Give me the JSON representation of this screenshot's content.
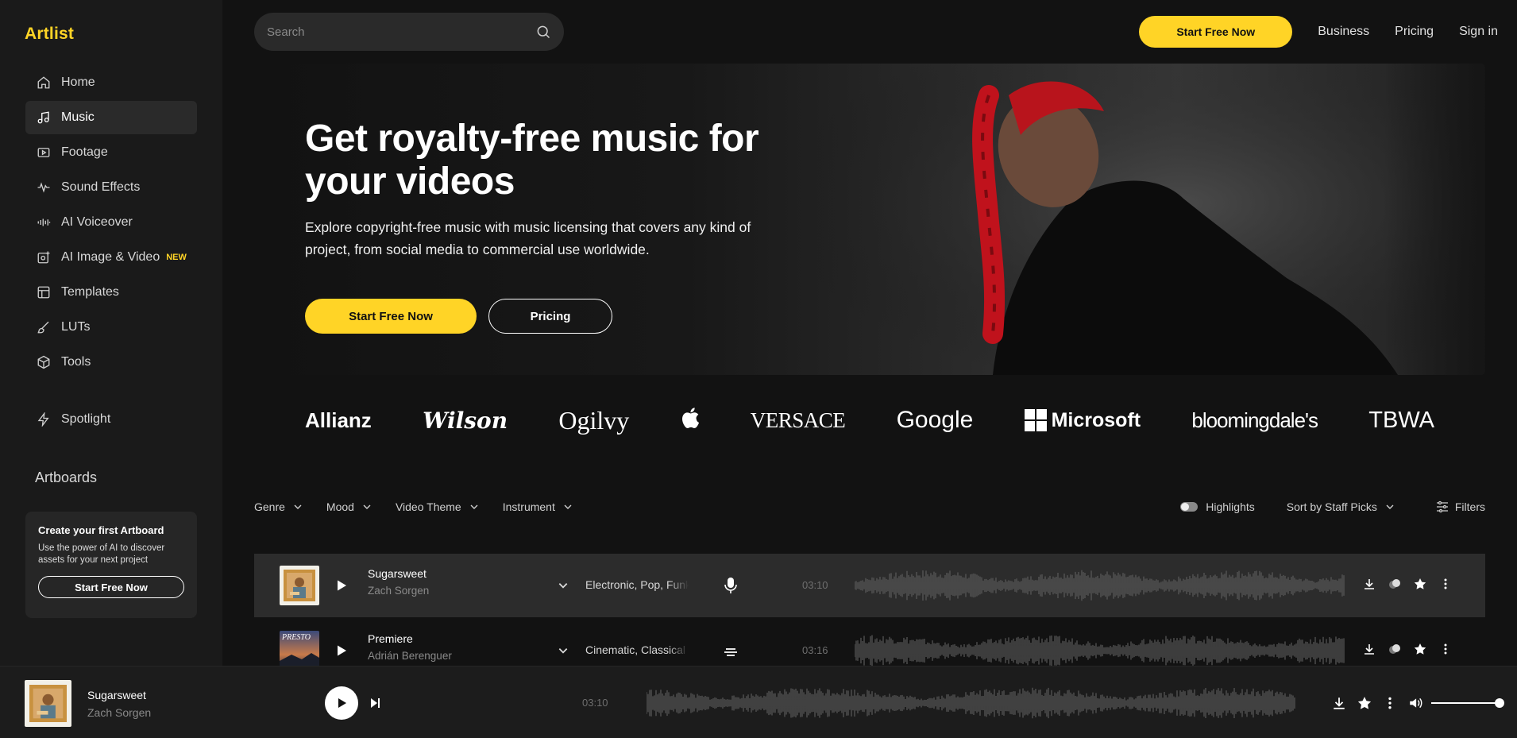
{
  "brand": {
    "logo": "Artlist"
  },
  "sidebar": {
    "items": [
      {
        "label": "Home",
        "icon": "home-icon"
      },
      {
        "label": "Music",
        "icon": "music-note-icon",
        "active": true
      },
      {
        "label": "Footage",
        "icon": "video-icon"
      },
      {
        "label": "Sound Effects",
        "icon": "waveform-icon"
      },
      {
        "label": "AI Voiceover",
        "icon": "voice-bars-icon"
      },
      {
        "label": "AI Image & Video",
        "icon": "ai-image-icon",
        "badge": "NEW"
      },
      {
        "label": "Templates",
        "icon": "templates-icon"
      },
      {
        "label": "LUTs",
        "icon": "brush-icon"
      },
      {
        "label": "Tools",
        "icon": "cube-icon"
      }
    ],
    "spotlight": "Spotlight",
    "artboards_title": "Artboards",
    "artboard_card": {
      "title": "Create your first Artboard",
      "body": "Use the power of AI to discover assets for your next project",
      "button": "Start Free Now"
    }
  },
  "search": {
    "placeholder": "Search"
  },
  "topnav": {
    "cta": "Start Free Now",
    "links": [
      "Business",
      "Pricing",
      "Sign in"
    ]
  },
  "hero": {
    "title": "Get royalty-free music for your videos",
    "subtitle": "Explore copyright-free music with music licensing that covers any kind of project, from social media to commercial use worldwide.",
    "primary_cta": "Start Free Now",
    "secondary_cta": "Pricing"
  },
  "brands": [
    "Allianz",
    "Wilson",
    "Ogilvy",
    "Apple",
    "VERSACE",
    "Google",
    "Microsoft",
    "bloomingdale's",
    "TBWA"
  ],
  "filters": {
    "items": [
      "Genre",
      "Mood",
      "Video Theme",
      "Instrument"
    ],
    "highlights": "Highlights",
    "sort": "Sort by Staff Picks",
    "filters": "Filters"
  },
  "tracks": [
    {
      "title": "Sugarsweet",
      "artist": "Zach Sorgen",
      "genres": "Electronic, Pop, Funk",
      "type_icon": "microphone-icon",
      "duration": "03:10"
    },
    {
      "title": "Premiere",
      "artist": "Adrián Berenguer",
      "genres": "Cinematic, Classical",
      "type_icon": "instrumental-icon",
      "duration": "03:16",
      "cover_text": "PRESTO"
    }
  ],
  "player": {
    "title": "Sugarsweet",
    "artist": "Zach Sorgen",
    "time": "03:10",
    "volume": 1.0
  },
  "colors": {
    "accent": "#ffd426",
    "background": "#121212",
    "sidebar": "#1a1a1a"
  }
}
